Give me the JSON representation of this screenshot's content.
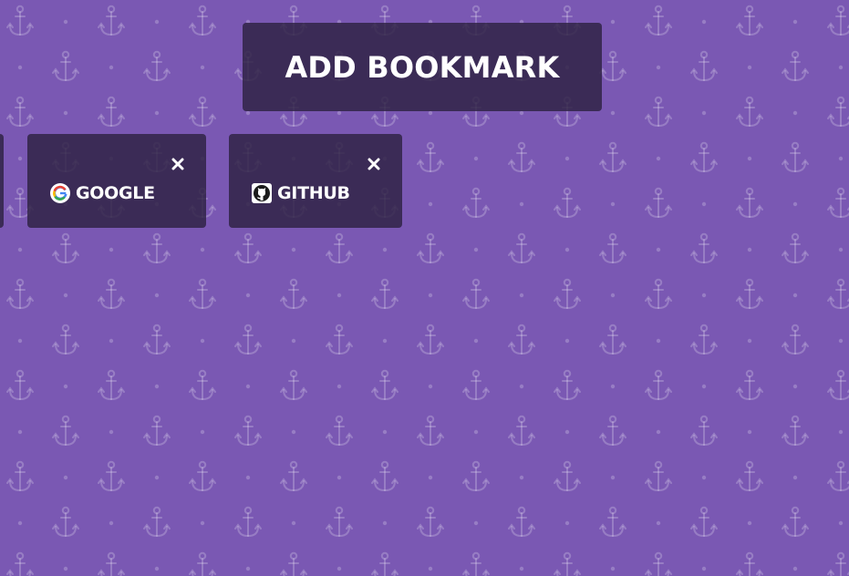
{
  "theme": {
    "background": "#7a58b3",
    "pattern_icon": "anchor-icon",
    "card_bg": "#2d2142"
  },
  "toolbar": {
    "add_bookmark_label": "ADD BOOKMARK"
  },
  "bookmarks": [
    {
      "label": "GOOGLE",
      "icon": "google-g-icon",
      "close_icon": "close-icon"
    },
    {
      "label": "GITHUB",
      "icon": "github-octocat-icon",
      "close_icon": "close-icon"
    }
  ]
}
